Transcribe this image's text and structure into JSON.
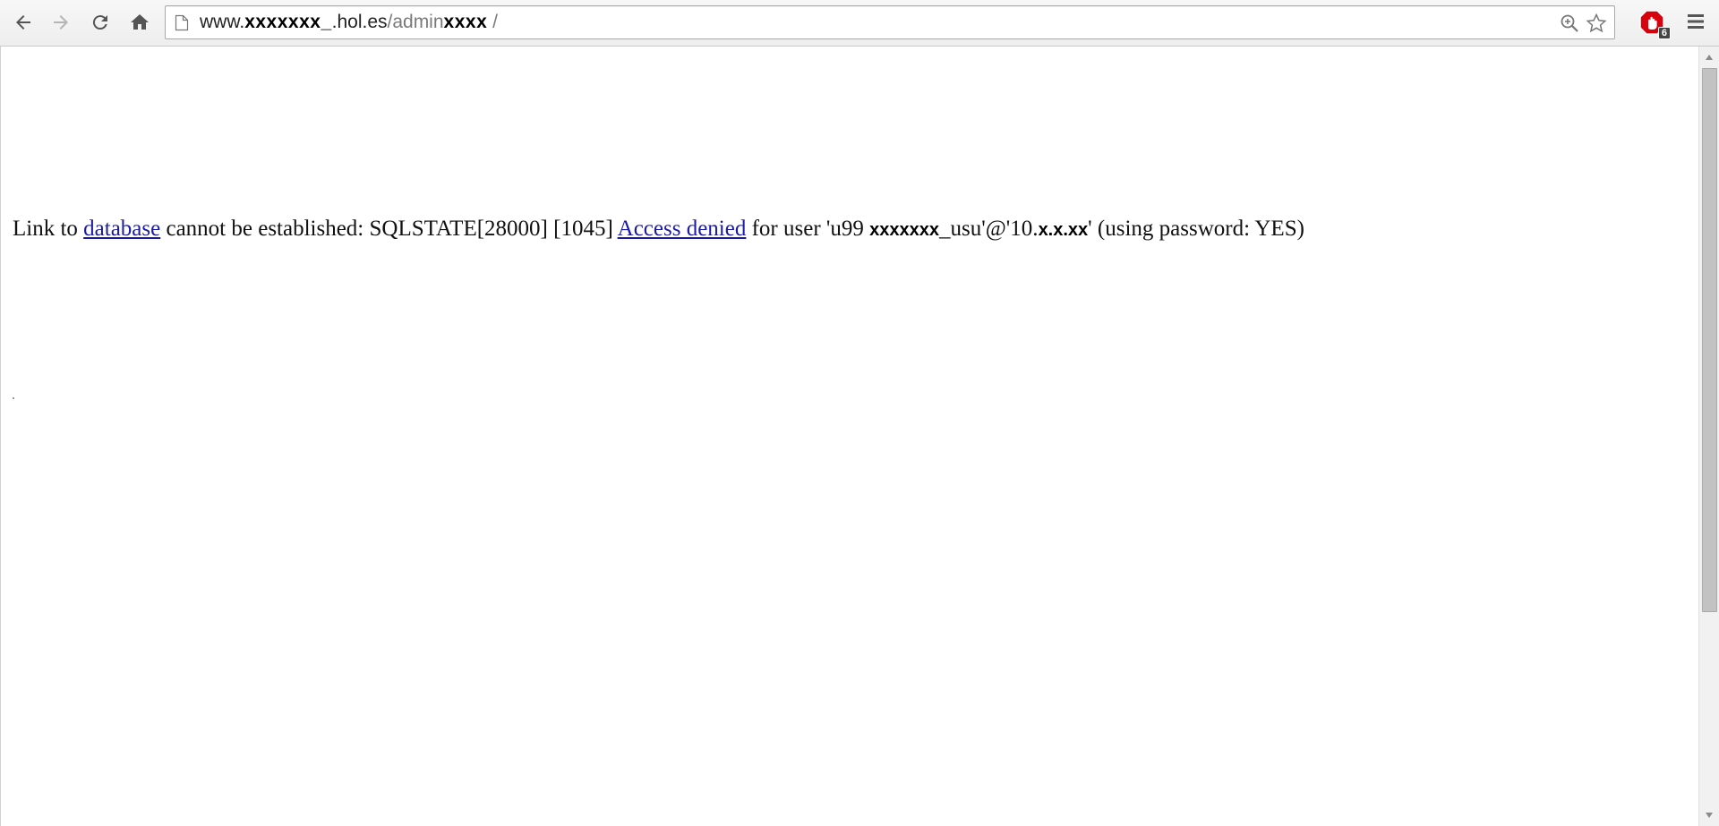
{
  "browser": {
    "url": {
      "prefix": "www.",
      "redacted_domain": "xxxxxxx_",
      "domain_suffix": ".hol.es",
      "path_start": "/admin",
      "redacted_path": "xxxx",
      "path_end": " /"
    },
    "extension_badge": "6",
    "icons": {
      "back": "back-arrow-icon",
      "forward": "forward-arrow-icon",
      "reload": "reload-icon",
      "home": "home-icon",
      "page": "page-icon",
      "zoom": "zoom-icon",
      "bookmark": "star-icon",
      "extension": "adblock-icon",
      "menu": "hamburger-menu-icon"
    }
  },
  "page": {
    "error": {
      "part1": "Link to ",
      "link1": "database",
      "part2": " cannot be established: SQLSTATE[28000] [1045] ",
      "link2": "Access denied",
      "part3": " for user 'u99",
      "redacted_user": "xxxxxxx",
      "part4": "_usu'@'10.",
      "redacted_ip": "x.x.xx",
      "part5": "' (using password: YES)"
    }
  },
  "colors": {
    "link": "#1a1aa6",
    "toolbar_bg": "#eeeeee",
    "text": "#111111"
  }
}
